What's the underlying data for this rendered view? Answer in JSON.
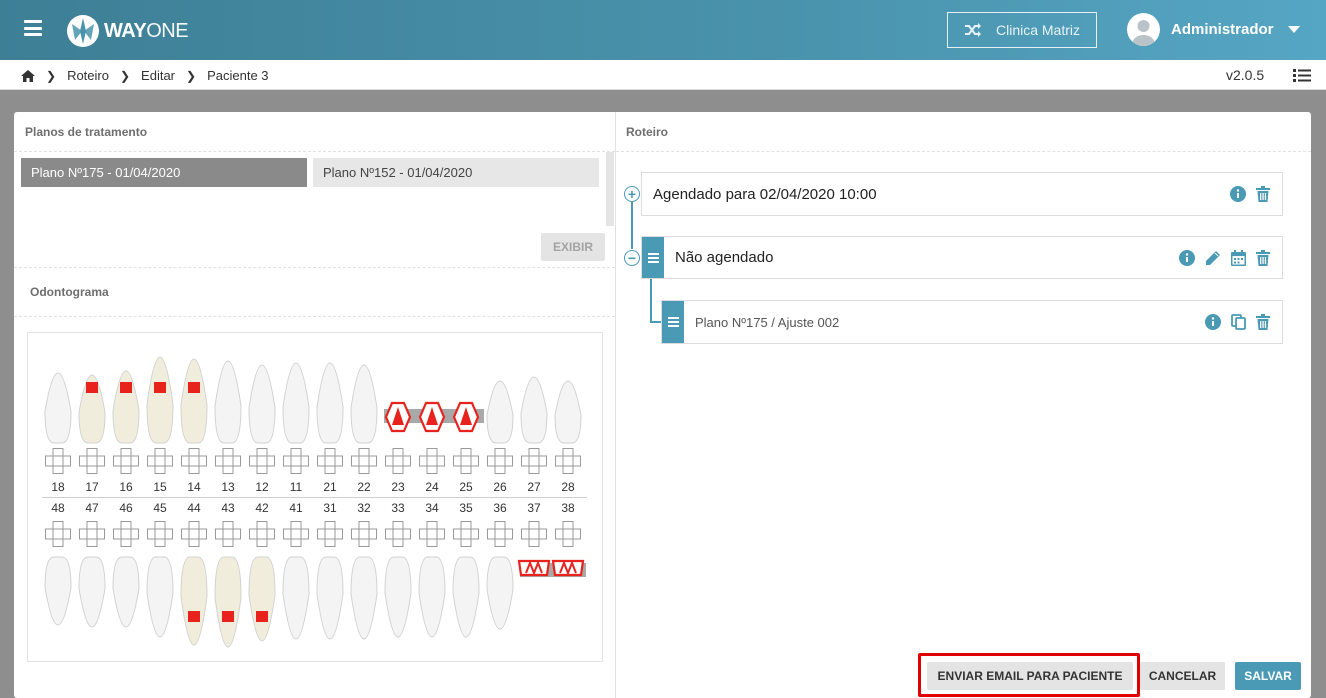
{
  "header": {
    "logo_text_bold": "WAY",
    "logo_text_light": "ONE",
    "clinic_button": "Clinica Matriz",
    "user_name": "Administrador"
  },
  "breadcrumb": {
    "items": [
      "Roteiro",
      "Editar",
      "Paciente 3"
    ],
    "version": "v2.0.5"
  },
  "left": {
    "plans_title": "Planos de tratamento",
    "plans": [
      {
        "label": "Plano Nº175 - 01/04/2020",
        "active": true
      },
      {
        "label": "Plano Nº152 - 01/04/2020",
        "active": false
      }
    ],
    "exibir_label": "EXIBIR",
    "odontogram_title": "Odontograma",
    "upper_teeth": [
      "18",
      "17",
      "16",
      "15",
      "14",
      "13",
      "12",
      "11",
      "21",
      "22",
      "23",
      "24",
      "25",
      "26",
      "27",
      "28"
    ],
    "lower_teeth": [
      "48",
      "47",
      "46",
      "45",
      "44",
      "43",
      "42",
      "41",
      "31",
      "32",
      "33",
      "34",
      "35",
      "36",
      "37",
      "38"
    ]
  },
  "right": {
    "title": "Roteiro",
    "items": [
      {
        "text": "Agendado para 02/04/2020 10:00"
      },
      {
        "text": "Não agendado"
      },
      {
        "text": "Plano Nº175 / Ajuste 002"
      }
    ]
  },
  "footer": {
    "email_button": "ENVIAR EMAIL PARA PACIENTE",
    "cancel_button": "CANCELAR",
    "save_button": "SALVAR"
  },
  "colors": {
    "accent": "#4a9ab6",
    "highlight": "#e00000",
    "marker": "#e8231e"
  },
  "icons": [
    "menu-icon",
    "wayone-logo-icon",
    "shuffle-icon",
    "user-avatar-icon",
    "home-icon",
    "list-icon",
    "info-icon",
    "trash-icon",
    "edit-icon",
    "calendar-icon",
    "copy-icon"
  ]
}
